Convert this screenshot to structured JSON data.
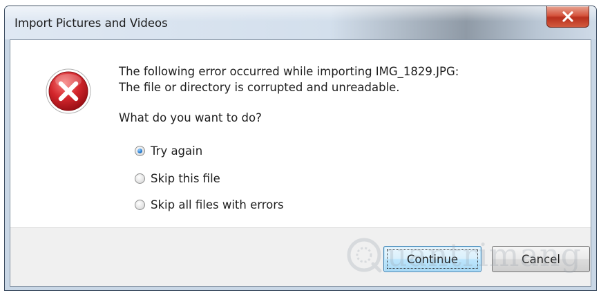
{
  "window": {
    "title": "Import Pictures and Videos",
    "close_label": "close"
  },
  "dialog": {
    "icon": "error-icon",
    "message_line1": "The following error occurred while importing IMG_1829.JPG:",
    "message_line2": "The file or directory is corrupted and unreadable.",
    "question": "What do you want to do?",
    "options": [
      {
        "label": "Try again",
        "selected": true
      },
      {
        "label": "Skip this file",
        "selected": false
      },
      {
        "label": "Skip all files with errors",
        "selected": false
      }
    ]
  },
  "buttons": {
    "continue_label": "Continue",
    "cancel_label": "Cancel"
  },
  "watermark": {
    "text": "uantrimang"
  },
  "colors": {
    "error_red": "#c8202a",
    "close_red": "#c8452b",
    "radio_blue": "#2b80d3",
    "default_button_border": "#3c7fb1"
  }
}
